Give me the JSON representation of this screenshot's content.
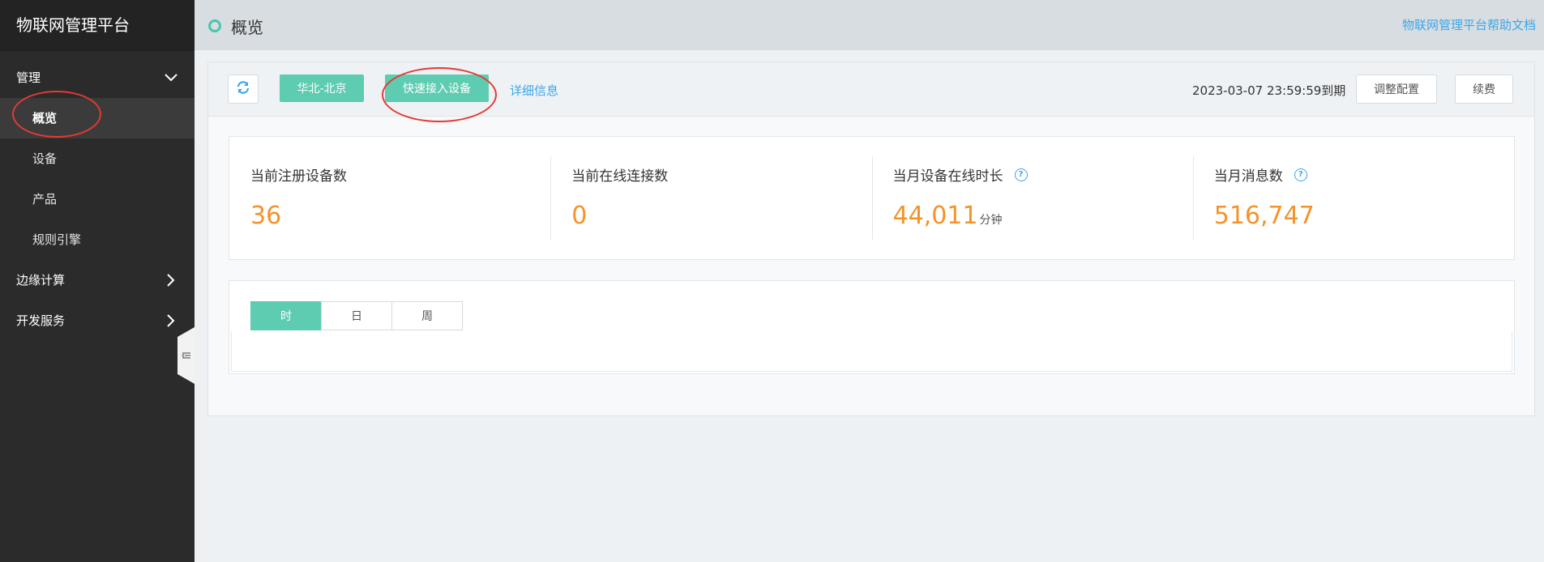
{
  "sidebar": {
    "brand": "物联网管理平台",
    "groups": [
      {
        "label": "管理",
        "expanded": true,
        "items": [
          "概览",
          "设备",
          "产品",
          "规则引擎"
        ]
      },
      {
        "label": "边缘计算",
        "expanded": false
      },
      {
        "label": "开发服务",
        "expanded": false
      }
    ],
    "active_item": "概览"
  },
  "header": {
    "title": "概览",
    "help_link": "物联网管理平台帮助文档"
  },
  "toolbar": {
    "region": "华北-北京",
    "quick_access": "快速接入设备",
    "detail": "详细信息",
    "expire": "2023-03-07 23:59:59到期",
    "adjust": "调整配置",
    "renew": "续费"
  },
  "stats": [
    {
      "label": "当前注册设备数",
      "value": "36",
      "unit": "",
      "help": false
    },
    {
      "label": "当前在线连接数",
      "value": "0",
      "unit": "",
      "help": false
    },
    {
      "label": "当月设备在线时长",
      "value": "44,011",
      "unit": "分钟",
      "help": true
    },
    {
      "label": "当月消息数",
      "value": "516,747",
      "unit": "",
      "help": true
    }
  ],
  "chart_tabs": [
    "时",
    "日",
    "周"
  ],
  "active_chart_tab": "时",
  "help_icon_glyph": "?",
  "colors": {
    "accent": "#5dccb0",
    "number": "#f5922b",
    "link": "#3ba7e8",
    "annotation": "#e53935"
  }
}
